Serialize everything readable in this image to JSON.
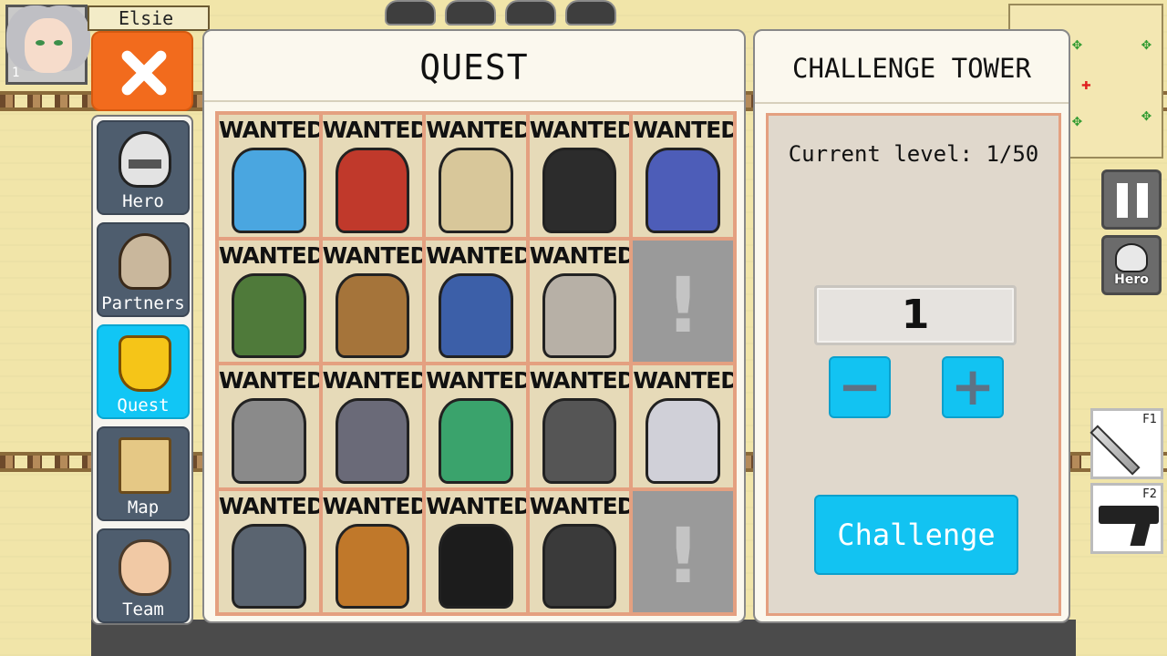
{
  "player": {
    "name": "Elsie",
    "level": "1"
  },
  "nav": {
    "items": [
      {
        "label": "Hero",
        "icon": "knight-helmet-icon"
      },
      {
        "label": "Partners",
        "icon": "viking-helmet-icon"
      },
      {
        "label": "Quest",
        "icon": "trophy-icon",
        "active": true
      },
      {
        "label": "Map",
        "icon": "map-scroll-icon"
      },
      {
        "label": "Team",
        "icon": "team-portrait-icon"
      }
    ]
  },
  "quest": {
    "title": "QUEST",
    "posters": [
      {
        "label": "WANTED",
        "color": "#4aa6e0"
      },
      {
        "label": "WANTED",
        "color": "#c0392b"
      },
      {
        "label": "WANTED",
        "color": "#d8c79a"
      },
      {
        "label": "WANTED",
        "color": "#2c2c2c"
      },
      {
        "label": "WANTED",
        "color": "#4d5db8"
      },
      {
        "label": "WANTED",
        "color": "#4f7a3a"
      },
      {
        "label": "WANTED",
        "color": "#a5743a"
      },
      {
        "label": "WANTED",
        "color": "#3c5fa8"
      },
      {
        "label": "WANTED",
        "color": "#b7b0a6"
      },
      {
        "label": "",
        "locked": true
      },
      {
        "label": "WANTED",
        "color": "#8a8a8a"
      },
      {
        "label": "WANTED",
        "color": "#6a6a78"
      },
      {
        "label": "WANTED",
        "color": "#3aa36c"
      },
      {
        "label": "WANTED",
        "color": "#555555"
      },
      {
        "label": "WANTED",
        "color": "#d0d0d8"
      },
      {
        "label": "WANTED",
        "color": "#5a6470"
      },
      {
        "label": "WANTED",
        "color": "#c0782a"
      },
      {
        "label": "WANTED",
        "color": "#1c1c1c"
      },
      {
        "label": "WANTED",
        "color": "#3a3a3a"
      },
      {
        "label": "",
        "locked": true
      }
    ],
    "locked_symbol": "!"
  },
  "challenge": {
    "title": "CHALLENGE TOWER",
    "current_level_text": "Current level: 1/50",
    "input_value": "1",
    "minus_label": "−",
    "plus_label": "+",
    "button_label": "Challenge"
  },
  "hud": {
    "hero_button_label": "Hero",
    "skill_1_key": "F1",
    "skill_2_key": "F2"
  },
  "colors": {
    "accent_blue": "#12c3f2",
    "close_orange": "#f26b1d",
    "grid_border": "#e4a080"
  }
}
